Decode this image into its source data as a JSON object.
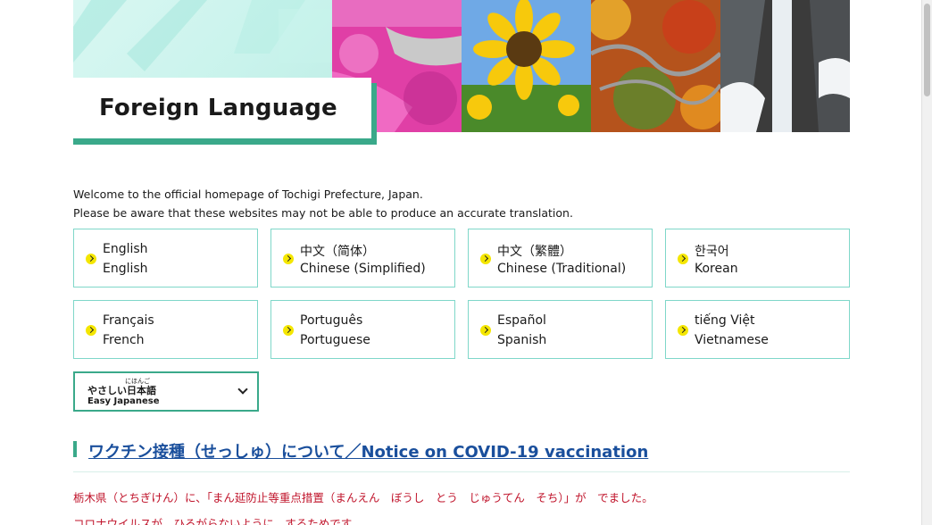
{
  "header": {
    "title": "Foreign Language"
  },
  "intro": {
    "line1": "Welcome to the official homepage of Tochigi Prefecture, Japan.",
    "line2": "Please be aware that these websites may not be able to produce an accurate translation."
  },
  "languages": [
    {
      "native": "English",
      "english": "English"
    },
    {
      "native": "中文（简体）",
      "english": "Chinese (Simplified)"
    },
    {
      "native": "中文（繁體）",
      "english": "Chinese (Traditional)"
    },
    {
      "native": "한국어",
      "english": "Korean"
    },
    {
      "native": "Français",
      "english": "French"
    },
    {
      "native": "Português",
      "english": "Portuguese"
    },
    {
      "native": "Español",
      "english": "Spanish"
    },
    {
      "native": "tiếng Việt",
      "english": "Vietnamese"
    }
  ],
  "easy_japanese": {
    "ruby": "にほんご",
    "japanese": "やさしい日本語",
    "english": "Easy Japanese"
  },
  "notice": {
    "link_text": "ワクチン接種（せっしゅ）について／Notice on COVID-19 vaccination"
  },
  "body_text": {
    "line1": "栃木県（とちぎけん）に、「まん延防止等重点措置（まんえん　ぼうし　とう　じゅうてん　そち）」が　でました。",
    "line2": "コロナウイルスが　ひろがらないように　するためです。"
  },
  "colors": {
    "accent": "#3aa98a",
    "card_border": "#7fd7c9",
    "bullet": "#f4e600",
    "link": "#1a4f9c",
    "alert": "#c0142b"
  }
}
